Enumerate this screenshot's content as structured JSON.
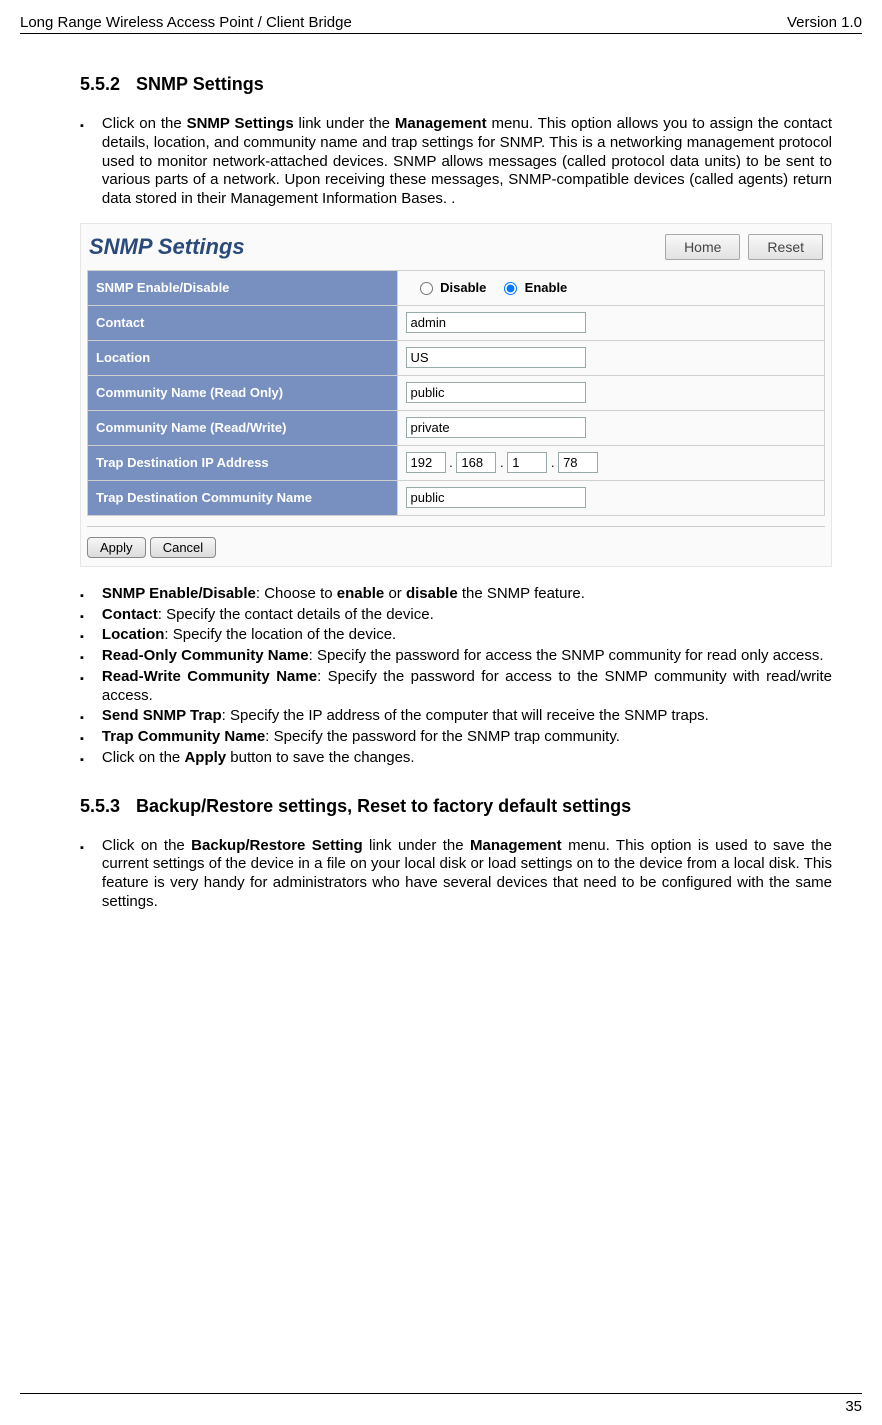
{
  "meta": {
    "header_left": "Long Range Wireless Access Point / Client Bridge",
    "header_right": "Version 1.0",
    "page_number": "35"
  },
  "section1": {
    "number": "5.5.2",
    "title": "SNMP Settings",
    "intro": {
      "pre": "Click on the ",
      "link": "SNMP Settings",
      "mid1": " link under the ",
      "menu": "Management",
      "post": " menu. This option allows you to assign the contact details, location, and community name and trap settings for SNMP. This is a networking management protocol used to monitor network-attached devices. SNMP allows messages (called protocol data units) to be sent to various parts of a network. Upon receiving these messages, SNMP-compatible devices (called agents) return data stored in their Management Information Bases. ."
    },
    "bullets": {
      "b1": {
        "bold": "SNMP Enable/Disable",
        "rest": ": Choose to ",
        "b1": "enable",
        "mid": " or ",
        "b2": "disable",
        "tail": " the SNMP feature."
      },
      "b2": {
        "bold": "Contact",
        "rest": ": Specify the contact details of the device."
      },
      "b3": {
        "bold": "Location",
        "rest": ": Specify the location of the device."
      },
      "b4": {
        "bold": "Read-Only Community Name",
        "rest": ": Specify the password for access the SNMP community for read only access."
      },
      "b5": {
        "bold": "Read-Write Community Name",
        "rest": ": Specify the password for access to the SNMP community with read/write access."
      },
      "b6": {
        "bold": "Send SNMP Trap",
        "rest": ": Specify the IP address of the computer that will receive the SNMP traps."
      },
      "b7": {
        "bold": "Trap Community Name",
        "rest": ": Specify the password for the SNMP trap community."
      },
      "b8": {
        "pre": "Click on the ",
        "bold": "Apply",
        "rest": " button to save the changes."
      }
    }
  },
  "section2": {
    "number": "5.5.3",
    "title": "Backup/Restore settings, Reset to factory default settings",
    "intro": {
      "pre": "Click on the ",
      "link": "Backup/Restore Setting",
      "mid1": " link under the ",
      "menu": "Management",
      "post": " menu. This option is used to save the current settings of the device in a file on your local disk or load settings on to the device from a local disk. This feature is very handy for administrators who have several devices that need to be configured with the same settings."
    }
  },
  "app": {
    "title": "SNMP Settings",
    "buttons": {
      "home": "Home",
      "reset": "Reset"
    },
    "rows": {
      "enable_label": "SNMP Enable/Disable",
      "disable_opt": "Disable",
      "enable_opt": "Enable",
      "contact_label": "Contact",
      "contact_value": "admin",
      "location_label": "Location",
      "location_value": "US",
      "comm_ro_label": "Community Name (Read Only)",
      "comm_ro_value": "public",
      "comm_rw_label": "Community Name (Read/Write)",
      "comm_rw_value": "private",
      "trap_ip_label": "Trap Destination IP Address",
      "ip1": "192",
      "ip2": "168",
      "ip3": "1",
      "ip4": "78",
      "trap_cn_label": "Trap Destination Community Name",
      "trap_cn_value": "public"
    },
    "apply": "Apply",
    "cancel": "Cancel"
  }
}
